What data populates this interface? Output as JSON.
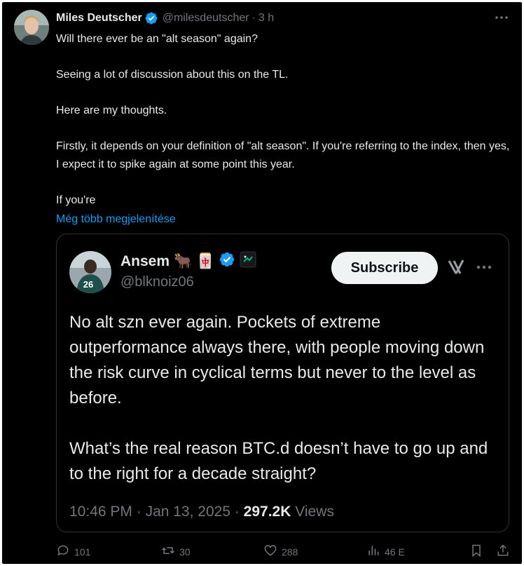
{
  "tweet": {
    "author_name": "Miles Deutscher",
    "handle": "@milesdeutscher",
    "separator": "·",
    "time": "3 h",
    "paragraphs": [
      "Will there ever be an \"alt season\" again?",
      "Seeing a lot of discussion about this on the TL.",
      "Here are my thoughts.",
      "Firstly, it depends on your definition of \"alt season\". If you're referring to the index, then yes, I expect it to spike again at some point this year.",
      "If you're"
    ],
    "show_more": "Még több megjelenítése"
  },
  "quote": {
    "author_name": "Ansem",
    "emoji_1": "🐂",
    "emoji_2": "🀄",
    "handle": "@blknoiz06",
    "subscribe_label": "Subscribe",
    "paragraphs": [
      "No alt szn ever again. Pockets of extreme outperformance always there, with people moving down the risk curve in cyclical terms but never to the level as before.",
      "What’s the real reason BTC.d doesn’t have to go up and to the right for a decade straight?"
    ],
    "time": "10:46 PM",
    "date": "Jan 13, 2025",
    "views_count": "297.2K",
    "views_label": "Views"
  },
  "actions": {
    "replies": "101",
    "reposts": "30",
    "likes": "288",
    "views": "46 E"
  },
  "icons": {
    "verified": "verified-badge-icon",
    "more": "more-dots-icon",
    "reply": "reply-icon",
    "repost": "repost-icon",
    "like": "heart-icon",
    "views": "bar-chart-icon",
    "bookmark": "bookmark-icon",
    "share": "share-icon",
    "grok": "grok-icon"
  },
  "colors": {
    "background": "#000000",
    "text": "#e7e9ea",
    "muted": "#71767b",
    "link": "#1d9bf0",
    "verified": "#1d9bf0"
  }
}
